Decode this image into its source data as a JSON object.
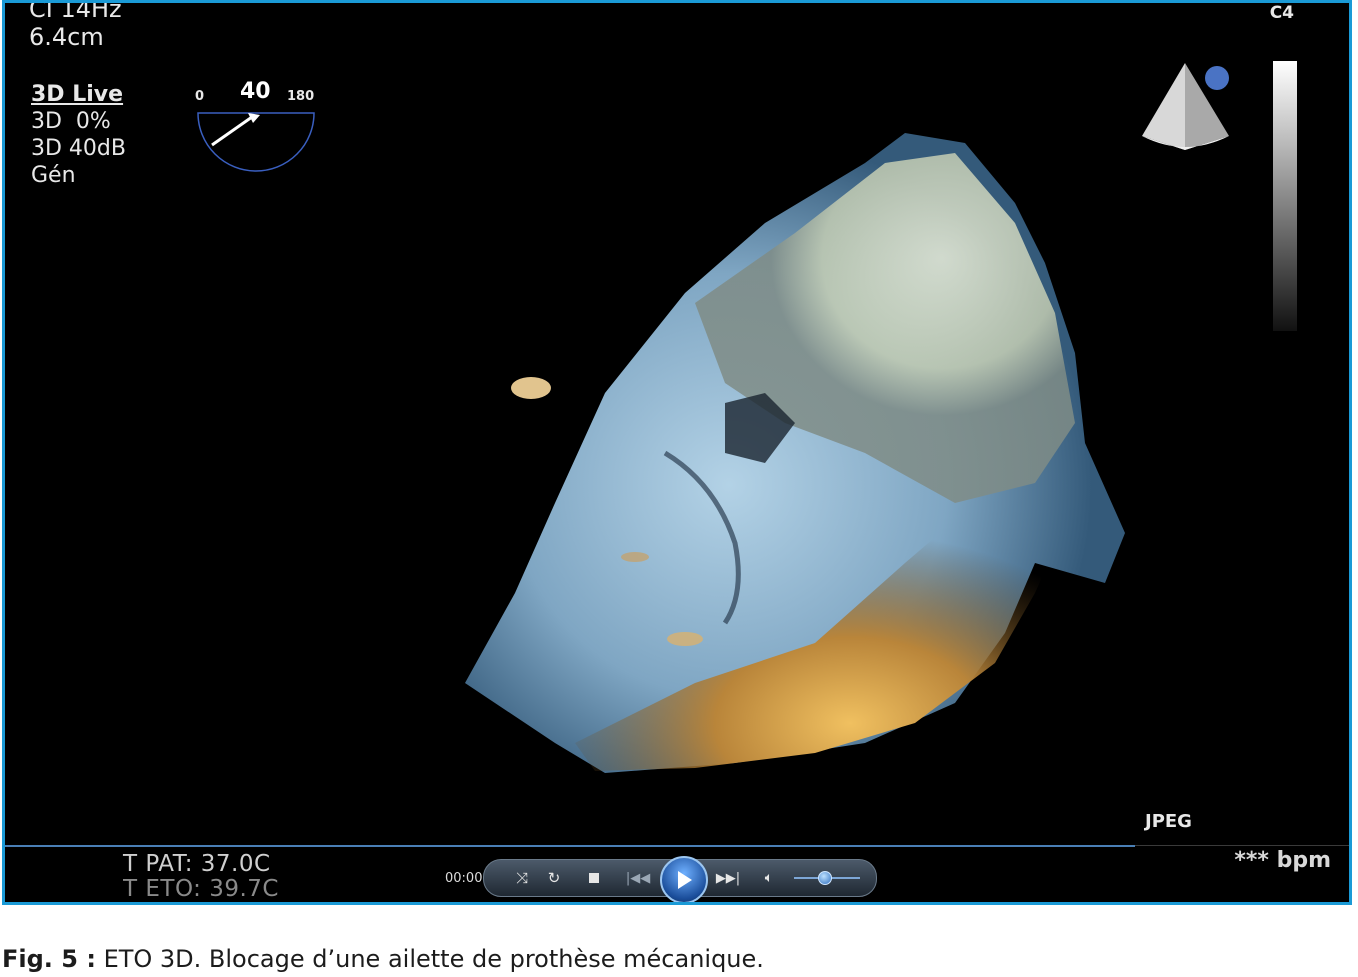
{
  "echo": {
    "top_line": "CI 14Hz",
    "depth": "6.4cm",
    "mode": "3D Live",
    "gain_pct": "3D  0%",
    "gain_db": "3D 40dB",
    "preset": "Gén",
    "angle_min": "0",
    "angle_value": "40",
    "angle_max": "180",
    "probe_label": "C4",
    "format": "JPEG",
    "temp_patient": "T PAT: 37.0C",
    "temp_eto": "T ETO: 39.7C",
    "heart_rate": "*** bpm"
  },
  "player": {
    "time": "00:00",
    "volume_level": 0.5,
    "icons": [
      "shuffle-icon",
      "repeat-icon",
      "stop-icon",
      "previous-icon",
      "play-icon",
      "next-icon",
      "volume-icon"
    ]
  },
  "caption": {
    "label": "Fig. 5 :",
    "text": " ETO 3D. Blocage d’une ailette de prothèse mécanique."
  },
  "colors": {
    "frame_border": "#1a9ad6",
    "background": "#000000",
    "tissue_blue": "#9fc2d8",
    "tissue_gold": "#d9a64a"
  }
}
